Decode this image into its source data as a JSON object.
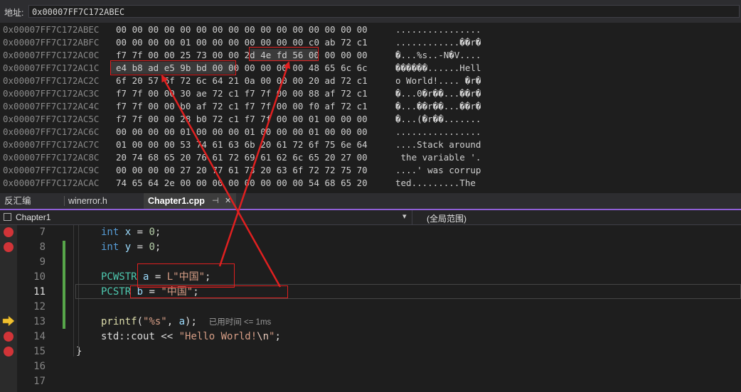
{
  "memory_window": {
    "address_label": "地址:",
    "address_value": "0x00007FF7C172ABEC",
    "rows": [
      {
        "addr": "0x00007FF7C172ABEC",
        "bytes": "00 00 00 00 00 00 00 00 00 00 00 00 00 00 00 00",
        "ascii": "................"
      },
      {
        "addr": "0x00007FF7C172ABFC",
        "bytes": "00 00 00 00 01 00 00 00 00 00 00 00 c0 ab 72 c1",
        "ascii": "............��r�"
      },
      {
        "addr": "0x00007FF7C172AC0C",
        "bytes": "f7 7f 00 00 25 73 00 00 2d 4e fd 56 00 00 00 00",
        "ascii": "�...%s..-N�V...."
      },
      {
        "addr": "0x00007FF7C172AC1C",
        "bytes": "e4 b8 ad e5 9b bd 00 00 00 00 00 00 48 65 6c 6c",
        "ascii": "������......Hell"
      },
      {
        "addr": "0x00007FF7C172AC2C",
        "bytes": "6f 20 57 6f 72 6c 64 21 0a 00 00 00 20 ad 72 c1",
        "ascii": "o World!.... �r�"
      },
      {
        "addr": "0x00007FF7C172AC3C",
        "bytes": "f7 7f 00 00 30 ae 72 c1 f7 7f 00 00 88 af 72 c1",
        "ascii": "�...0�r��...��r�"
      },
      {
        "addr": "0x00007FF7C172AC4C",
        "bytes": "f7 7f 00 00 b0 af 72 c1 f7 7f 00 00 f0 af 72 c1",
        "ascii": "�...��r��...��r�"
      },
      {
        "addr": "0x00007FF7C172AC5C",
        "bytes": "f7 7f 00 00 28 b0 72 c1 f7 7f 00 00 01 00 00 00",
        "ascii": "�...(�r��......."
      },
      {
        "addr": "0x00007FF7C172AC6C",
        "bytes": "00 00 00 00 01 00 00 00 01 00 00 00 01 00 00 00",
        "ascii": "................"
      },
      {
        "addr": "0x00007FF7C172AC7C",
        "bytes": "01 00 00 00 53 74 61 63 6b 20 61 72 6f 75 6e 64",
        "ascii": "....Stack around"
      },
      {
        "addr": "0x00007FF7C172AC8C",
        "bytes": "20 74 68 65 20 76 61 72 69 61 62 6c 65 20 27 00",
        "ascii": " the variable '."
      },
      {
        "addr": "0x00007FF7C172AC9C",
        "bytes": "00 00 00 00 27 20 77 61 73 20 63 6f 72 72 75 70",
        "ascii": "....' was corrup"
      },
      {
        "addr": "0x00007FF7C172ACAC",
        "bytes": "74 65 64 2e 00 00 00 00 00 00 00 00 54 68 65 20",
        "ascii": "ted.........The "
      }
    ]
  },
  "tabs": [
    {
      "label": "反汇编"
    },
    {
      "label": "winerror.h"
    },
    {
      "label": "Chapter1.cpp",
      "pin": "⊣",
      "close": "✕"
    }
  ],
  "nav": {
    "project": "Chapter1",
    "scope": "(全局范围)",
    "dropdown": "▾"
  },
  "editor": {
    "lines": [
      {
        "n": "7"
      },
      {
        "n": "8"
      },
      {
        "n": "9"
      },
      {
        "n": "10"
      },
      {
        "n": "11"
      },
      {
        "n": "12"
      },
      {
        "n": "13"
      },
      {
        "n": "14"
      },
      {
        "n": "15"
      },
      {
        "n": "16"
      },
      {
        "n": "17"
      }
    ],
    "code": {
      "l7": {
        "kw": "int",
        "var": "x",
        "rest": " = ",
        "num": "0",
        "end": ";"
      },
      "l8": {
        "kw": "int",
        "var": "y",
        "rest": " = ",
        "num": "0",
        "end": ";"
      },
      "l10": {
        "ty": "PCWSTR",
        "var": "a",
        "eq": " = ",
        "str": "L\"中国\"",
        "end": ";"
      },
      "l11": {
        "ty": "PCSTR",
        "var": "b",
        "eq": " = ",
        "str": "\"中国\"",
        "end": ";"
      },
      "l13": {
        "fn": "printf",
        "open": "(",
        "str": "\"%s\"",
        "comma": ", ",
        "var": "a",
        "close": ");",
        "hint": "已用时间 <= 1ms"
      },
      "l14": {
        "pre": "std",
        "sep": "::",
        "obj": "cout",
        "op": " << ",
        "str": "\"Hello World!",
        "esc": "\\n",
        "strend": "\"",
        "end": ";"
      },
      "l15": {
        "brace": "}"
      }
    }
  },
  "colors": {
    "annotation": "#e02020",
    "breakpoint": "#d13438",
    "arrow": "#f0c030",
    "accent": "#8f5fd6"
  }
}
